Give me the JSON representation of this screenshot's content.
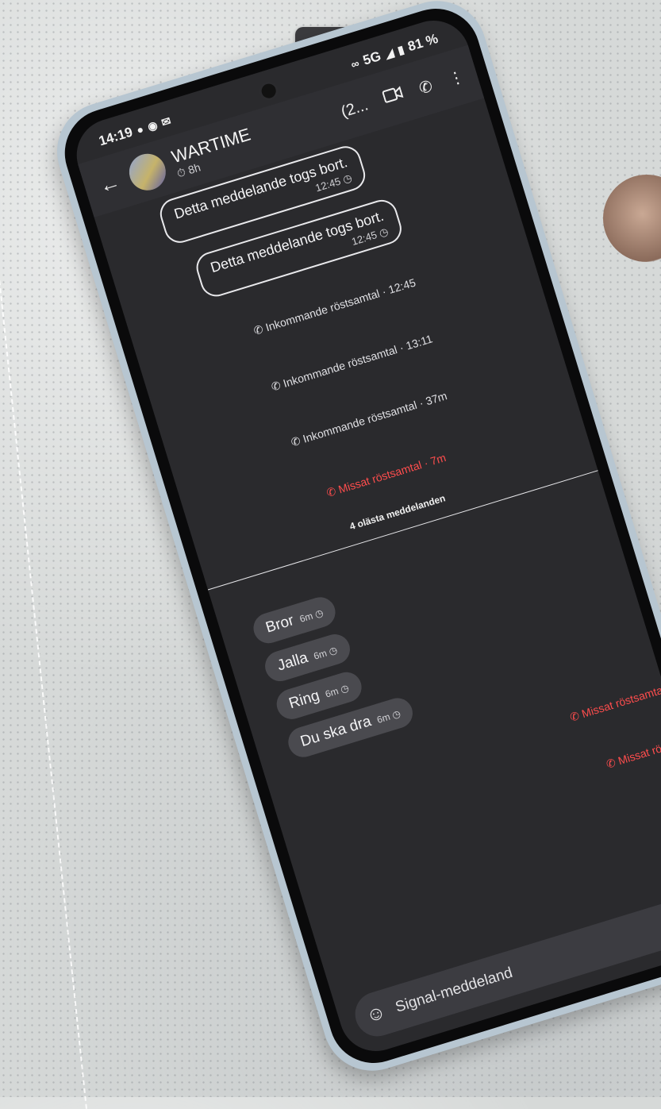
{
  "overlay": {
    "buttons": [
      {
        "icon": "exit-fullscreen-icon"
      },
      {
        "icon": "video-sparkle-icon"
      }
    ]
  },
  "status_bar": {
    "time": "14:19",
    "network": "5G",
    "battery": "81 %"
  },
  "header": {
    "title": "WARTIME",
    "timer": "8h",
    "group_count": "(2...",
    "icons": [
      "back-arrow-icon",
      "video-call-icon",
      "phone-icon",
      "more-menu-icon"
    ]
  },
  "messages": {
    "outgoing": [
      {
        "text": "Detta meddelande togs bort.",
        "time": "12:45"
      },
      {
        "text": "Detta meddelande togs bort.",
        "time": "12:45"
      }
    ],
    "calls": [
      {
        "text": "Inkommande röstsamtal · 12:45",
        "missed": false
      },
      {
        "text": "Inkommande röstsamtal · 13:11",
        "missed": false
      },
      {
        "text": "Inkommande röstsamtal · 37m",
        "missed": false
      },
      {
        "text": "Missat röstsamtal · 7m",
        "missed": true
      }
    ],
    "unread_divider": "4 olästa meddelanden",
    "incoming": [
      {
        "text": "Bror",
        "time": "6m"
      },
      {
        "text": "Jalla",
        "time": "6m"
      },
      {
        "text": "Ring",
        "time": "6m"
      },
      {
        "text": "Du ska dra",
        "time": "6m"
      }
    ],
    "calls_after": [
      {
        "text": "Missat röstsamtal",
        "missed": true
      },
      {
        "text": "Missat röstsa",
        "missed": true
      }
    ]
  },
  "composer": {
    "placeholder": "Signal-meddeland"
  },
  "colors": {
    "missed": "#ff4d4d",
    "screen_bg": "#2a2a2d",
    "incoming_bubble": "#4a4a4f"
  }
}
